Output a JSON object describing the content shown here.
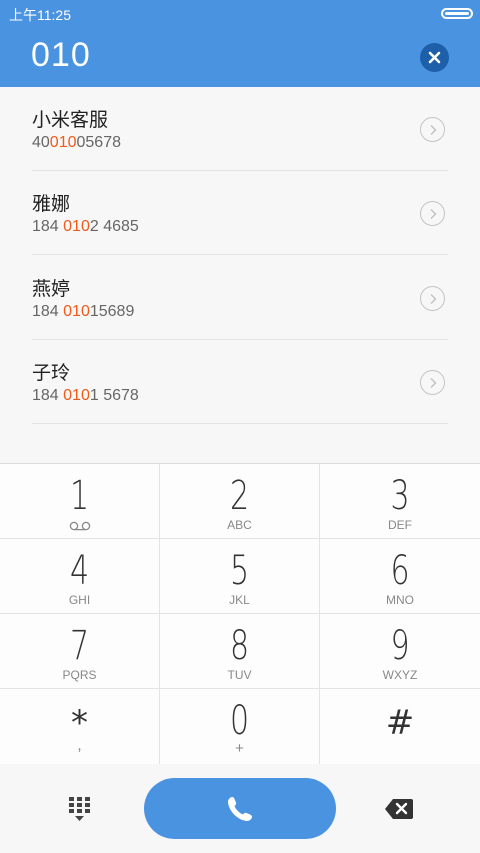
{
  "status_bar": {
    "time": "上午11:25"
  },
  "dial": {
    "number": "010"
  },
  "contacts": [
    {
      "name": "小米客服",
      "phone_pre": "40",
      "phone_hl": "010",
      "phone_post": "05678"
    },
    {
      "name": "雅娜",
      "phone_pre": "184 ",
      "phone_hl": "010",
      "phone_post": "2 4685"
    },
    {
      "name": "燕婷",
      "phone_pre": "184 ",
      "phone_hl": "010",
      "phone_post": "15689"
    },
    {
      "name": "子玲",
      "phone_pre": "184 ",
      "phone_hl": "010",
      "phone_post": "1 5678"
    }
  ],
  "keys": [
    {
      "digit": "1",
      "letters": ""
    },
    {
      "digit": "2",
      "letters": "ABC"
    },
    {
      "digit": "3",
      "letters": "DEF"
    },
    {
      "digit": "4",
      "letters": "GHI"
    },
    {
      "digit": "5",
      "letters": "JKL"
    },
    {
      "digit": "6",
      "letters": "MNO"
    },
    {
      "digit": "7",
      "letters": "PQRS"
    },
    {
      "digit": "8",
      "letters": "TUV"
    },
    {
      "digit": "9",
      "letters": "WXYZ"
    },
    {
      "digit": "*",
      "letters": ","
    },
    {
      "digit": "0",
      "letters": "+"
    },
    {
      "digit": "#",
      "letters": ""
    }
  ],
  "colors": {
    "accent": "#4a93e0",
    "highlight": "#f05a19",
    "clear_button": "#1d5fa8"
  },
  "icons": [
    "voicemail-icon",
    "clear-icon",
    "chevron-right-icon",
    "dialpad-icon",
    "phone-icon",
    "backspace-icon"
  ]
}
